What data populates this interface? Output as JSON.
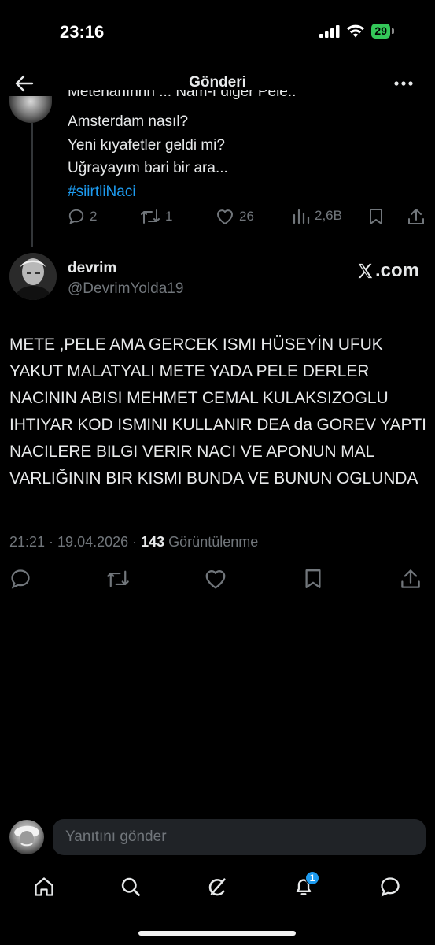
{
  "status_bar": {
    "time": "23:16",
    "battery": "29"
  },
  "header": {
    "title": "Gönderi"
  },
  "previous_tweet": {
    "cut_line": "Metehanınnn ... Nam-ı diğer Pele..",
    "lines": [
      "Amsterdam nasıl?",
      "Yeni kıyafetler geldi mi?",
      "Uğrayayım bari bir ara..."
    ],
    "hashtag": "#siirtliNaci",
    "counts": {
      "replies": "2",
      "reposts": "1",
      "likes": "26",
      "views": "2,6B"
    }
  },
  "tweet": {
    "display_name": "devrim",
    "handle": "@DevrimYolda19",
    "source_label": ".com",
    "body": "METE ,PELE AMA GERCEK ISMI HÜSEYİN UFUK YAKUT MALATYALI METE YADA PELE DERLER NACININ ABISI MEHMET CEMAL KULAKSIZOGLU IHTIYAR KOD ISMINI KULLANIR DEA da GOREV YAPTI NACILERE BILGI VERIR NACI VE APONUN MAL VARLIĞININ BIR KISMI BUNDA VE BUNUN OGLUNDA",
    "time": "21:21 · 19.04.2026 · ",
    "views_count": "143",
    "views_label": " Görüntülenme"
  },
  "reply_bar": {
    "placeholder": "Yanıtını gönder"
  },
  "tabbar": {
    "notification_badge": "1"
  },
  "colors": {
    "background": "#000000",
    "text": "#e7e9ea",
    "muted": "#71767b",
    "accent": "#1d9bf0",
    "battery": "#34c759"
  }
}
